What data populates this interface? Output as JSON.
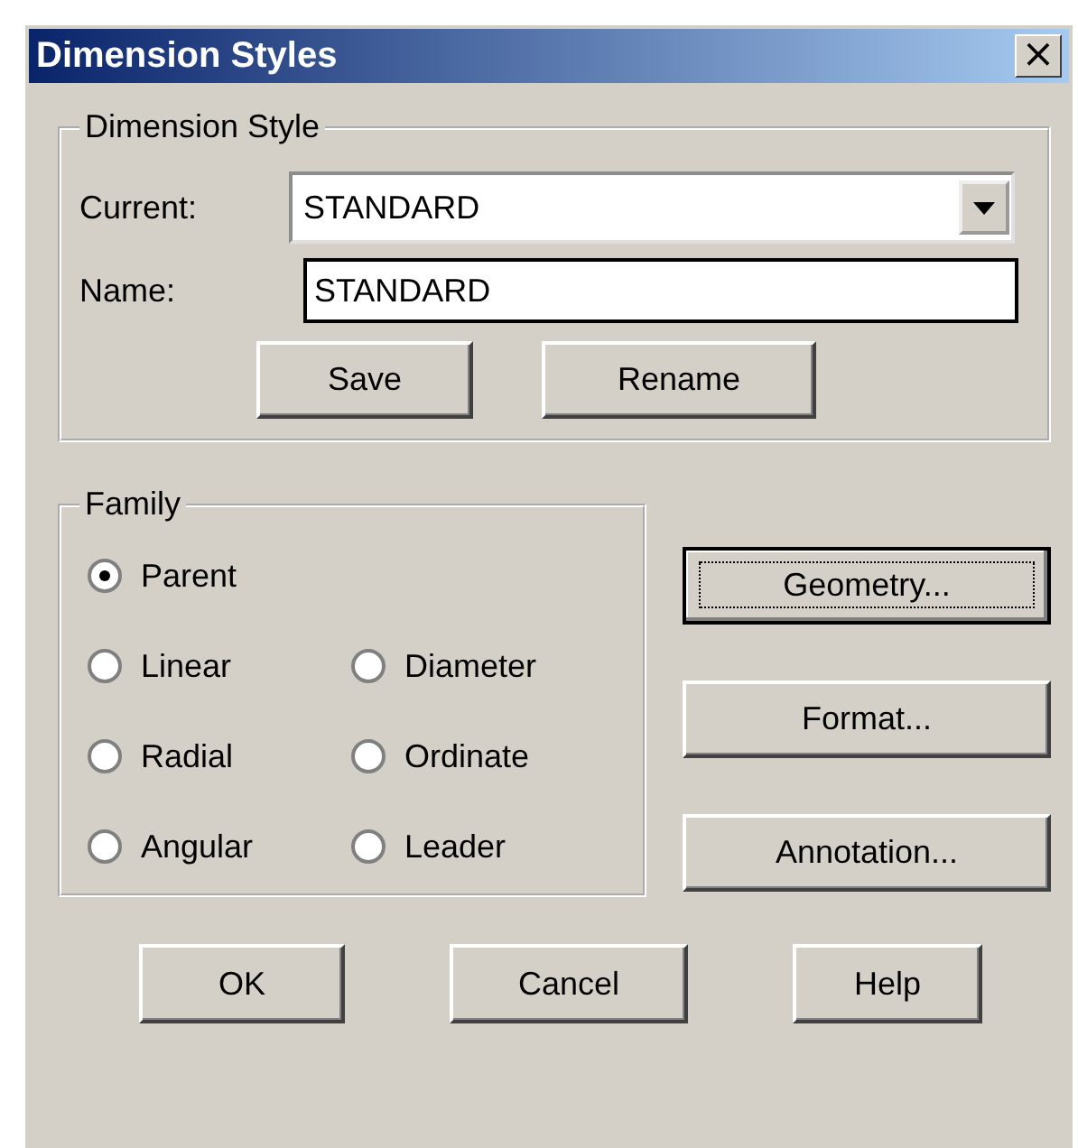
{
  "window": {
    "title": "Dimension Styles",
    "close": "×"
  },
  "dimension_style": {
    "title": "Dimension Style",
    "current": {
      "label": "Current:",
      "value": "STANDARD"
    },
    "name": {
      "label": "Name:",
      "value": "STANDARD"
    },
    "buttons": [
      {
        "label": "Save"
      },
      {
        "label": "Rename"
      }
    ]
  },
  "family": {
    "title": "Family",
    "options": [
      {
        "label": "Parent",
        "selected": true
      },
      {
        "label": "Linear",
        "selected": false
      },
      {
        "label": "Diameter",
        "selected": false
      },
      {
        "label": "Radial",
        "selected": false
      },
      {
        "label": "Ordinate",
        "selected": false
      },
      {
        "label": "Angular",
        "selected": false
      },
      {
        "label": "Leader",
        "selected": false
      }
    ]
  },
  "side_buttons": [
    {
      "label": "Geometry...",
      "focused": true
    },
    {
      "label": "Format...",
      "focused": false
    },
    {
      "label": "Annotation...",
      "focused": false
    }
  ],
  "bottom_buttons": [
    {
      "label": "OK"
    },
    {
      "label": "Cancel"
    },
    {
      "label": "Help"
    }
  ]
}
